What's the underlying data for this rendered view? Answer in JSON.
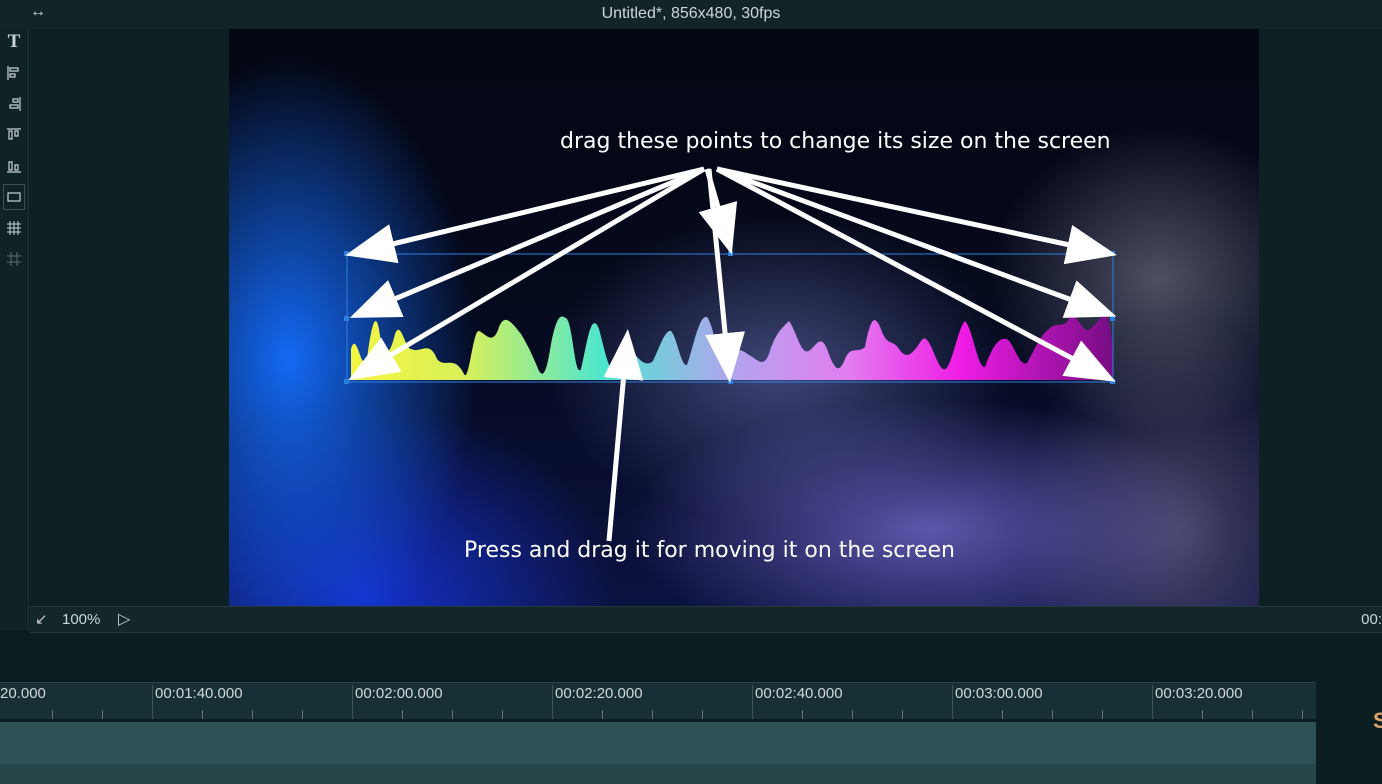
{
  "window": {
    "title": "Untitled*, 856x480, 30fps",
    "expand_icon": "double-arrow-icon"
  },
  "toolbar": {
    "tools": [
      {
        "icon": "text-tool-icon",
        "glyph": "T"
      },
      {
        "icon": "align-left-icon",
        "glyph": "≡"
      },
      {
        "icon": "align-right-icon",
        "glyph": "≡"
      },
      {
        "icon": "align-top-icon",
        "glyph": "⫪"
      },
      {
        "icon": "align-bottom-icon",
        "glyph": "⫫"
      },
      {
        "icon": "safe-frame-icon",
        "glyph": "▭"
      },
      {
        "icon": "grid-icon",
        "glyph": "▦"
      },
      {
        "icon": "guides-icon",
        "glyph": "#"
      }
    ]
  },
  "preview": {
    "annotation_top": "drag these points to change its size on the screen",
    "annotation_bottom": "Press and drag it for moving it on the screen",
    "colors": {
      "waveform": [
        "#f2f542",
        "#4de8c8",
        "#b7a6f0",
        "#f21de8",
        "#7a0f86"
      ],
      "selection": "#2f7fe0"
    }
  },
  "statusbar": {
    "fit_icon": "fit-arrow-icon",
    "zoom": "100%",
    "play_icon": "play-icon",
    "time": "00:"
  },
  "timeline": {
    "labels": [
      "20.000",
      "00:01:40.000",
      "00:02:00.000",
      "00:02:20.000",
      "00:02:40.000",
      "00:03:00.000",
      "00:03:20.000"
    ],
    "side_peek": "S"
  }
}
